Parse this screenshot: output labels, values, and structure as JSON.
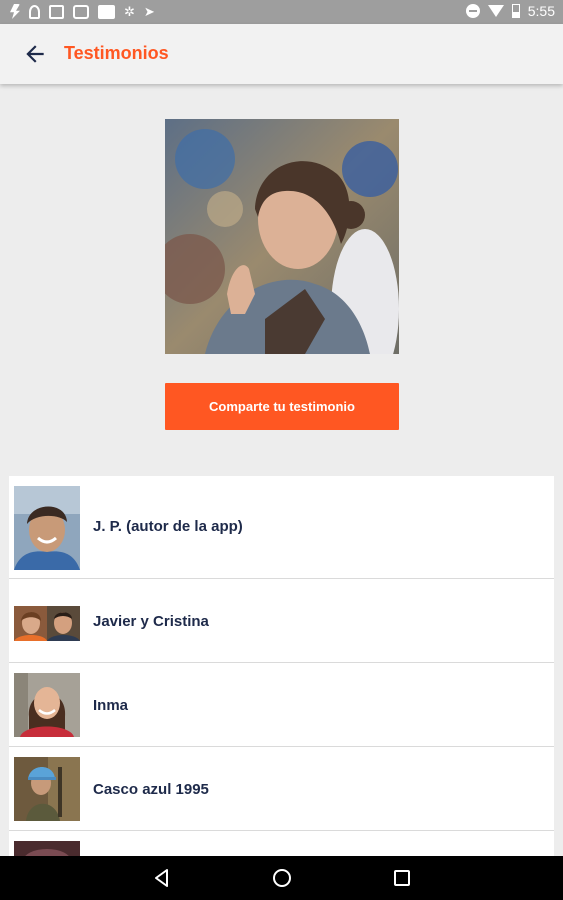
{
  "status_bar": {
    "time": "5:55",
    "left_icons": [
      "flash-icon",
      "lock-icon",
      "image-icon",
      "camera-icon",
      "gallery-icon",
      "sync-icon",
      "send-icon"
    ],
    "right_icons": [
      "do-not-disturb-icon",
      "wifi-icon",
      "battery-icon"
    ]
  },
  "app_bar": {
    "title": "Testimonios",
    "back_icon": "arrow-back-icon"
  },
  "hero": {
    "image": "woman-praying-photo"
  },
  "cta": {
    "label": "Comparte tu testimonio"
  },
  "testimonials": [
    {
      "name": "J. P. (autor de la app)",
      "thumb": "man-smiling-photo"
    },
    {
      "name": "Javier y Cristina",
      "thumb": "couple-photo"
    },
    {
      "name": "Inma",
      "thumb": "woman-photo"
    },
    {
      "name": "Casco azul 1995",
      "thumb": "soldier-photo"
    },
    {
      "name": "",
      "thumb": "partial-photo"
    }
  ],
  "nav_bar": {
    "icons": [
      "back-triangle-icon",
      "home-circle-icon",
      "recents-square-icon"
    ]
  },
  "colors": {
    "accent": "#FF5722",
    "list_text": "#1E2A4A",
    "background": "#EDEDED",
    "status_bar": "#9E9E9E"
  }
}
